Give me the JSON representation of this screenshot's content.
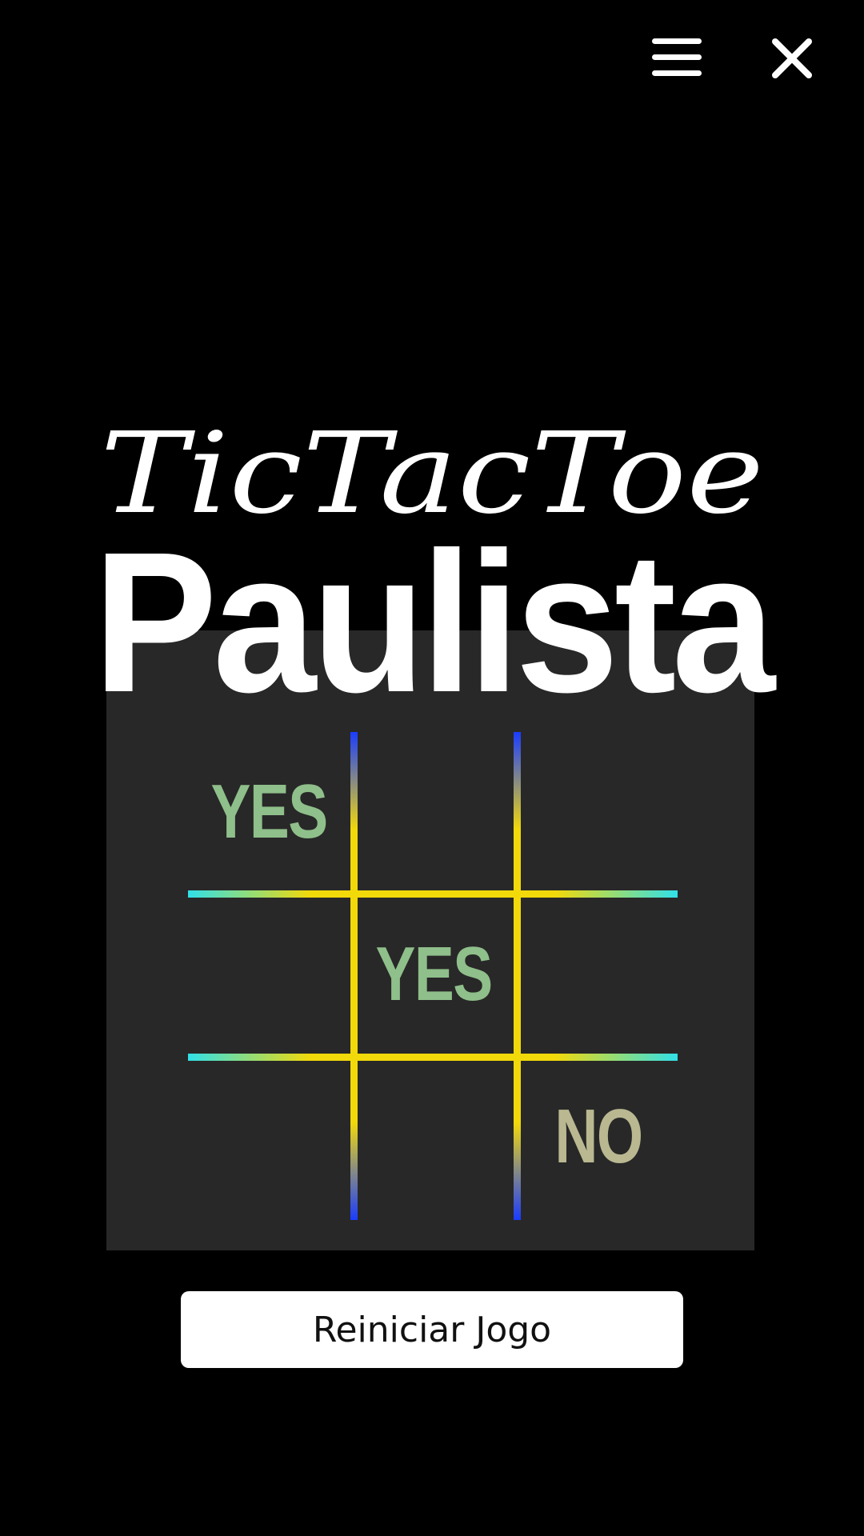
{
  "header": {
    "menu_icon": "hamburger-menu-icon",
    "close_icon": "close-icon"
  },
  "title": {
    "script_line": "TicTacToe",
    "bold_line": "Paulista"
  },
  "board": {
    "cells": [
      {
        "mark": "YES",
        "kind": "yes"
      },
      {
        "mark": "",
        "kind": ""
      },
      {
        "mark": "",
        "kind": ""
      },
      {
        "mark": "",
        "kind": ""
      },
      {
        "mark": "YES",
        "kind": "yes"
      },
      {
        "mark": "",
        "kind": ""
      },
      {
        "mark": "",
        "kind": ""
      },
      {
        "mark": "",
        "kind": ""
      },
      {
        "mark": "NO",
        "kind": "no"
      }
    ]
  },
  "actions": {
    "restart_label": "Reiniciar Jogo"
  },
  "colors": {
    "background": "#000000",
    "board": "#282828",
    "grid_yellow": "#f2d90a",
    "grid_blue": "#1a3cff",
    "grid_cyan": "#30e0e8",
    "mark_yes": "#8fbf8a",
    "mark_no": "#b9b891"
  }
}
